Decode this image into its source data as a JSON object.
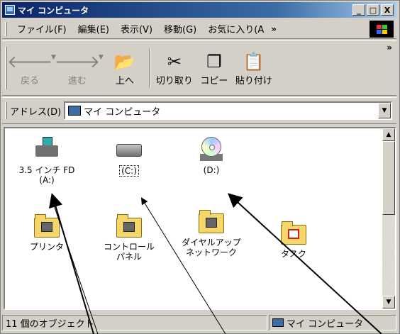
{
  "window": {
    "title": "マイ コンピュータ"
  },
  "controls": {
    "min": "_",
    "max": "□",
    "close": "X"
  },
  "menu": {
    "items": [
      "ファイル(F)",
      "編集(E)",
      "表示(V)",
      "移動(G)",
      "お気に入り(A"
    ],
    "more": "»"
  },
  "toolbar": {
    "back": "戻る",
    "forward": "進む",
    "up": "上へ",
    "cut": "切り取り",
    "copy": "コピー",
    "paste": "貼り付け",
    "more": "»"
  },
  "address": {
    "label": "アドレス(D)",
    "value": "マイ コンピュータ"
  },
  "items": {
    "fd": "3.5 インチ FD\n(A:)",
    "c": "(C:)",
    "d": "(D:)",
    "printers": "プリンタ",
    "control": "コントロール\nパネル",
    "dialup": "ダイヤルアップ\nネットワーク",
    "tasks": "タスク"
  },
  "status": {
    "count": "11 個のオブジェクト",
    "location": "マイ コンピュータ"
  }
}
